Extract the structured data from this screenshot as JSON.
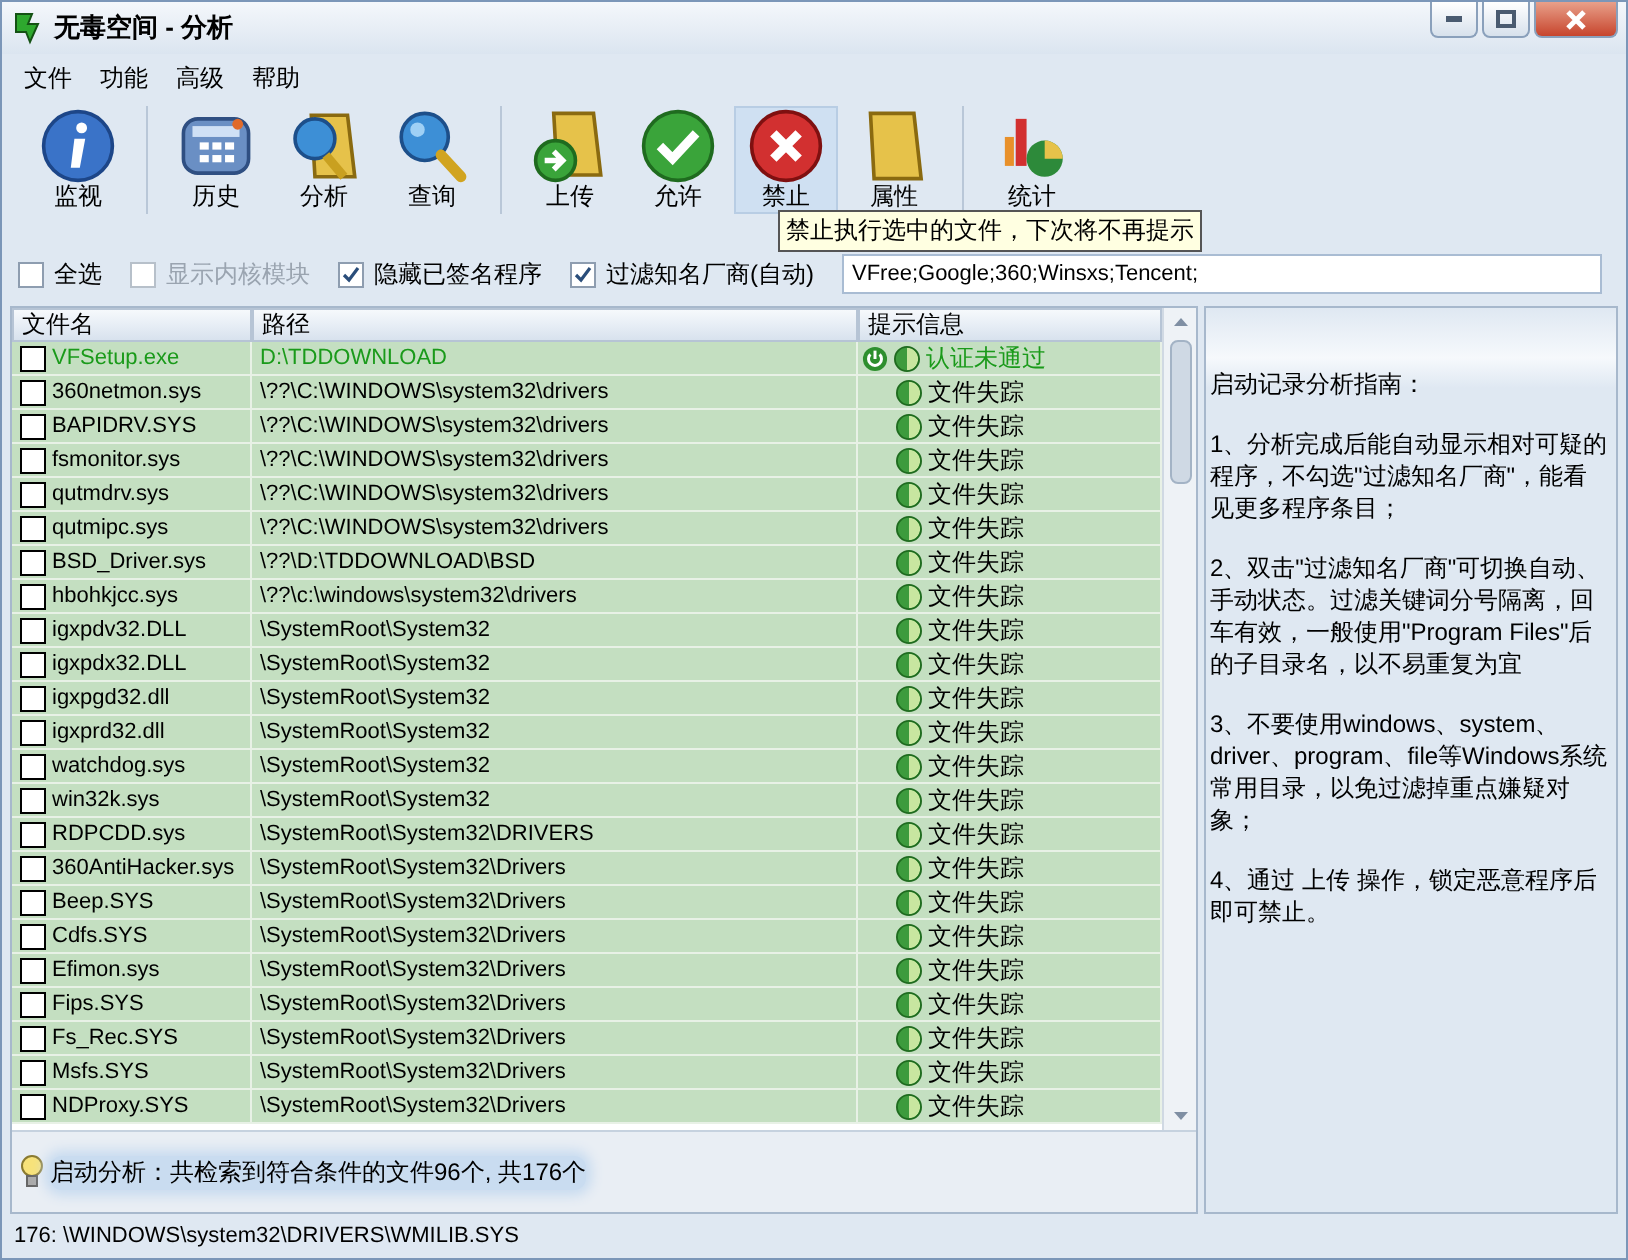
{
  "window": {
    "title": "无毒空间 - 分析"
  },
  "menu": [
    "文件",
    "功能",
    "高级",
    "帮助"
  ],
  "toolbar": {
    "groups": [
      [
        {
          "label": "监视",
          "kind": "info",
          "hovered": false
        }
      ],
      [
        {
          "label": "历史",
          "kind": "history",
          "hovered": false
        },
        {
          "label": "分析",
          "kind": "analyze",
          "hovered": false
        },
        {
          "label": "查询",
          "kind": "query",
          "hovered": false
        }
      ],
      [
        {
          "label": "上传",
          "kind": "upload",
          "hovered": false
        },
        {
          "label": "允许",
          "kind": "allow",
          "hovered": false
        },
        {
          "label": "禁止",
          "kind": "block",
          "hovered": true
        },
        {
          "label": "属性",
          "kind": "properties",
          "hovered": false
        }
      ],
      [
        {
          "label": "统计",
          "kind": "stats",
          "hovered": false
        }
      ]
    ],
    "tooltip": "禁止执行选中的文件，下次将不再提示"
  },
  "filters": [
    {
      "label": "全选",
      "checked": false,
      "disabled": false
    },
    {
      "label": "显示内核模块",
      "checked": false,
      "disabled": true
    },
    {
      "label": "隐藏已签名程序",
      "checked": true,
      "disabled": false
    },
    {
      "label": "过滤知名厂商(自动)",
      "checked": true,
      "disabled": false
    }
  ],
  "filter_field": {
    "value": "VFree;Google;360;Winsxs;Tencent;"
  },
  "table": {
    "columns": [
      "文件名",
      "路径",
      "提示信息"
    ],
    "rows": [
      {
        "name": "VFSetup.exe",
        "path": "D:\\TDDOWNLOAD",
        "info": "认证未通过",
        "kind": "unverified",
        "checked": false
      },
      {
        "name": "360netmon.sys",
        "path": "\\??\\C:\\WINDOWS\\system32\\drivers",
        "info": "文件失踪",
        "kind": "missing",
        "checked": false
      },
      {
        "name": "BAPIDRV.SYS",
        "path": "\\??\\C:\\WINDOWS\\system32\\drivers",
        "info": "文件失踪",
        "kind": "missing",
        "checked": false
      },
      {
        "name": "fsmonitor.sys",
        "path": "\\??\\C:\\WINDOWS\\system32\\drivers",
        "info": "文件失踪",
        "kind": "missing",
        "checked": false
      },
      {
        "name": "qutmdrv.sys",
        "path": "\\??\\C:\\WINDOWS\\system32\\drivers",
        "info": "文件失踪",
        "kind": "missing",
        "checked": false
      },
      {
        "name": "qutmipc.sys",
        "path": "\\??\\C:\\WINDOWS\\system32\\drivers",
        "info": "文件失踪",
        "kind": "missing",
        "checked": false
      },
      {
        "name": "BSD_Driver.sys",
        "path": "\\??\\D:\\TDDOWNLOAD\\BSD",
        "info": "文件失踪",
        "kind": "missing",
        "checked": false
      },
      {
        "name": "hbohkjcc.sys",
        "path": "\\??\\c:\\windows\\system32\\drivers",
        "info": "文件失踪",
        "kind": "missing",
        "checked": false
      },
      {
        "name": "igxpdv32.DLL",
        "path": "\\SystemRoot\\System32",
        "info": "文件失踪",
        "kind": "missing",
        "checked": false
      },
      {
        "name": "igxpdx32.DLL",
        "path": "\\SystemRoot\\System32",
        "info": "文件失踪",
        "kind": "missing",
        "checked": false
      },
      {
        "name": "igxpgd32.dll",
        "path": "\\SystemRoot\\System32",
        "info": "文件失踪",
        "kind": "missing",
        "checked": false
      },
      {
        "name": "igxprd32.dll",
        "path": "\\SystemRoot\\System32",
        "info": "文件失踪",
        "kind": "missing",
        "checked": false
      },
      {
        "name": "watchdog.sys",
        "path": "\\SystemRoot\\System32",
        "info": "文件失踪",
        "kind": "missing",
        "checked": false
      },
      {
        "name": "win32k.sys",
        "path": "\\SystemRoot\\System32",
        "info": "文件失踪",
        "kind": "missing",
        "checked": false
      },
      {
        "name": "RDPCDD.sys",
        "path": "\\SystemRoot\\System32\\DRIVERS",
        "info": "文件失踪",
        "kind": "missing",
        "checked": false
      },
      {
        "name": "360AntiHacker.sys",
        "path": "\\SystemRoot\\System32\\Drivers",
        "info": "文件失踪",
        "kind": "missing",
        "checked": false
      },
      {
        "name": "Beep.SYS",
        "path": "\\SystemRoot\\System32\\Drivers",
        "info": "文件失踪",
        "kind": "missing",
        "checked": false
      },
      {
        "name": "Cdfs.SYS",
        "path": "\\SystemRoot\\System32\\Drivers",
        "info": "文件失踪",
        "kind": "missing",
        "checked": false
      },
      {
        "name": "Efimon.sys",
        "path": "\\SystemRoot\\System32\\Drivers",
        "info": "文件失踪",
        "kind": "missing",
        "checked": false
      },
      {
        "name": "Fips.SYS",
        "path": "\\SystemRoot\\System32\\Drivers",
        "info": "文件失踪",
        "kind": "missing",
        "checked": false
      },
      {
        "name": "Fs_Rec.SYS",
        "path": "\\SystemRoot\\System32\\Drivers",
        "info": "文件失踪",
        "kind": "missing",
        "checked": false
      },
      {
        "name": "Msfs.SYS",
        "path": "\\SystemRoot\\System32\\Drivers",
        "info": "文件失踪",
        "kind": "missing",
        "checked": false
      },
      {
        "name": "NDProxy.SYS",
        "path": "\\SystemRoot\\System32\\Drivers",
        "info": "文件失踪",
        "kind": "missing",
        "checked": false
      }
    ]
  },
  "result_message": "启动分析：共检索到符合条件的文件96个, 共176个",
  "guide": [
    "启动记录分析指南：",
    "1、分析完成后能自动显示相对可疑的程序，不勾选\"过滤知名厂商\"，能看见更多程序条目；",
    "2、双击\"过滤知名厂商\"可切换自动、手动状态。过滤关键词分号隔离，回车有效，一般使用\"Program Files\"后的子目录名，以不易重复为宜",
    "3、不要使用windows、system、driver、program、file等Windows系统常用目录，以免过滤掉重点嫌疑对象；",
    "4、通过 上传 操作，锁定恶意程序后即可禁止。"
  ],
  "status_bar": "176: \\WINDOWS\\system32\\DRIVERS\\WMILIB.SYS"
}
